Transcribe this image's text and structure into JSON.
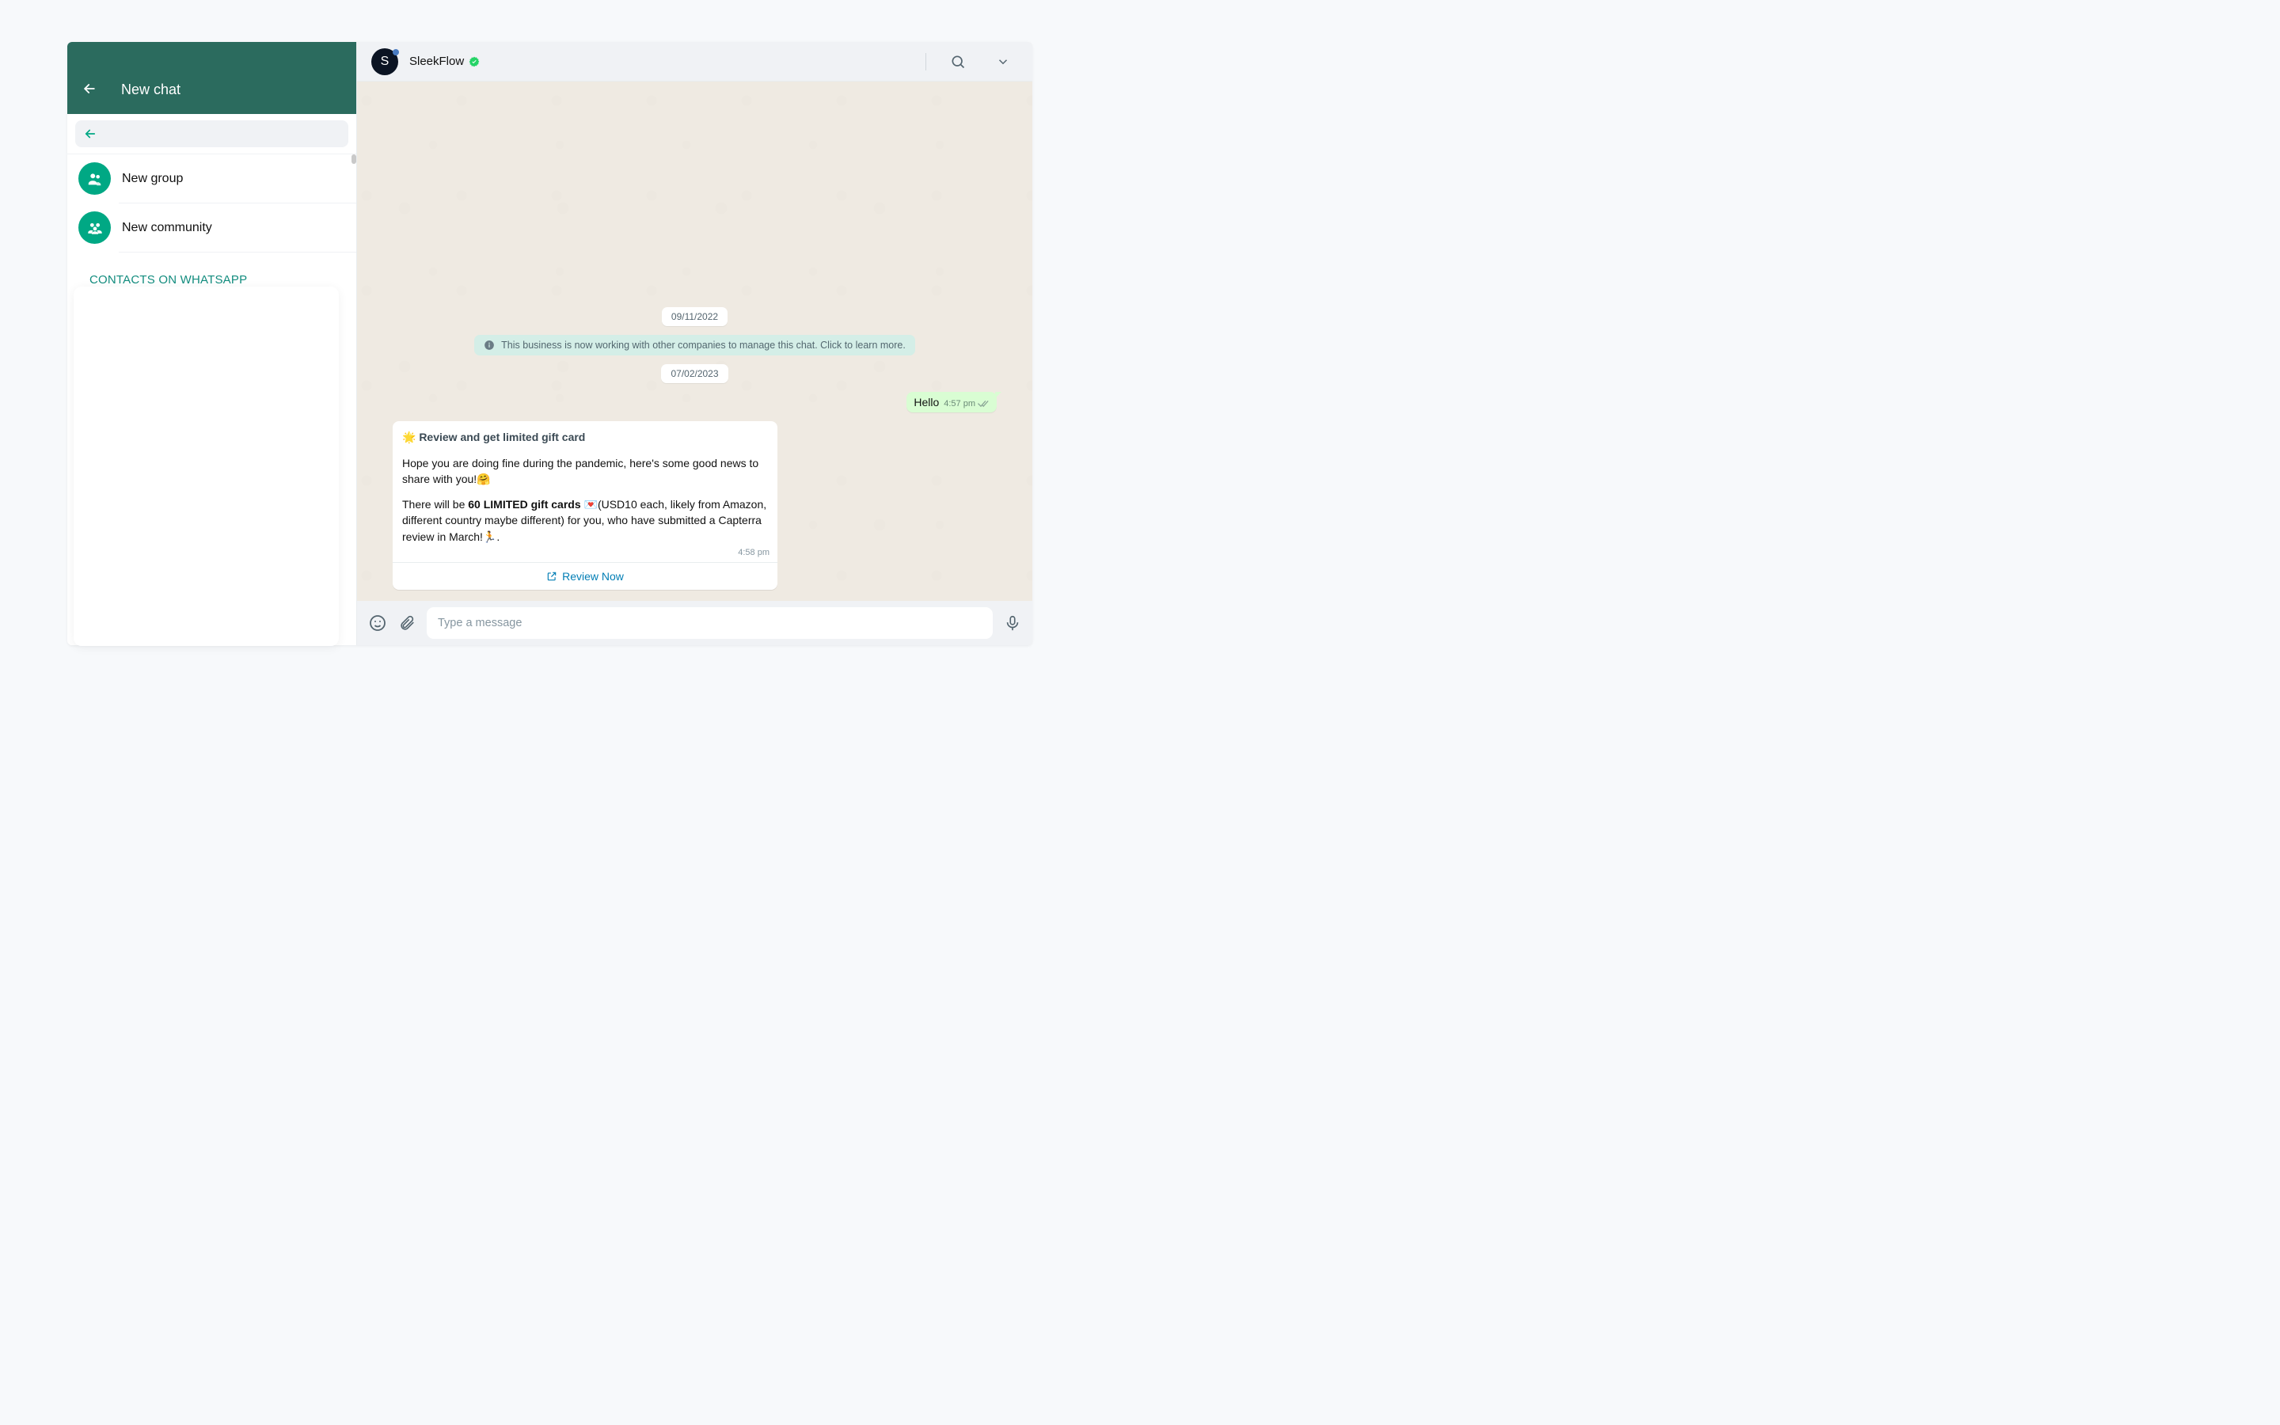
{
  "left": {
    "title": "New chat",
    "newGroup": "New group",
    "newCommunity": "New community",
    "sectionHeader": "CONTACTS ON WHATSAPP"
  },
  "chat": {
    "name": "SleekFlow",
    "avatarInitial": "S",
    "date1": "09/11/2022",
    "date2": "07/02/2023",
    "notice": "This business is now working with other companies to manage this chat. Click to learn more.",
    "outgoing": {
      "text": "Hello",
      "time": "4:57 pm"
    },
    "incoming": {
      "headline": "🌟 Review and get limited gift card",
      "p1": "Hope you are doing fine during the pandemic, here's some good news to share with you!🤗",
      "p2a": "There will be ",
      "p2bold": "60 LIMITED gift cards",
      "p2b": " 💌(USD10 each, likely from Amazon, different country maybe different) for you, who have submitted a Capterra review in March!🏃.",
      "time": "4:58 pm",
      "action": "Review Now"
    },
    "composerPlaceholder": "Type a message"
  }
}
